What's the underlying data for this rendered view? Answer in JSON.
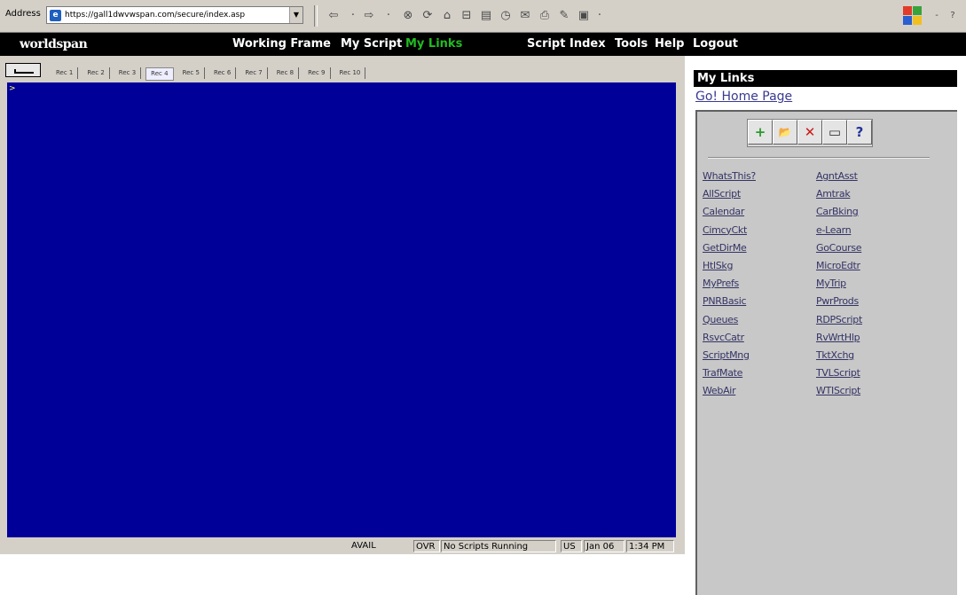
{
  "browser": {
    "address_label": "Address",
    "url": "https://gall1dwvwspan.com/secure/index.asp",
    "toolbar_icons": [
      "back-icon",
      "forward-icon",
      "stop-icon",
      "refresh-icon",
      "home-icon",
      "search-icon",
      "favorites-icon",
      "history-icon",
      "mail-icon",
      "print-icon",
      "edit-icon",
      "discuss-icon"
    ]
  },
  "app": {
    "brand": "worldspan",
    "nav": {
      "working_frame": "Working Frame",
      "my_script": "My Script",
      "my_links": "My Links",
      "script_index": "Script Index",
      "tools": "Tools",
      "help": "Help",
      "logout": "Logout"
    },
    "active_nav": "My Links",
    "accent_color": "#22bb22"
  },
  "work_area": {
    "rec_tabs": [
      "Rec 1",
      "Rec 2",
      "Rec 3",
      "Rec 4",
      "Rec 5",
      "Rec 6",
      "Rec 7",
      "Rec 8",
      "Rec 9",
      "Rec 10"
    ],
    "active_rec_tab": "Rec 4",
    "terminal_color": "#000099",
    "prompt": ">"
  },
  "status_bar": {
    "avail": "AVAIL",
    "ovr": "OVR",
    "script_status": "No Scripts Running",
    "locale": "US",
    "date": "Jan 06",
    "time": "1:34 PM"
  },
  "my_links": {
    "title": "My Links",
    "home_link": "Go! Home Page",
    "toolbar": [
      {
        "icon": "add-icon",
        "glyph": "+"
      },
      {
        "icon": "open-folder-icon",
        "glyph": "📂"
      },
      {
        "icon": "delete-icon",
        "glyph": "✕"
      },
      {
        "icon": "window-icon",
        "glyph": "▭"
      },
      {
        "icon": "help-icon",
        "glyph": "?"
      }
    ],
    "col1": [
      "WhatsThis?",
      "AllScript",
      "Calendar",
      "CimcyCkt",
      "GetDirMe",
      "HtlSkg",
      "MyPrefs",
      "PNRBasic",
      "Queues",
      "RsvcCatr",
      "ScriptMng",
      "TrafMate",
      "WebAir"
    ],
    "col2": [
      "AgntAsst",
      "Amtrak",
      "CarBking",
      "e-Learn",
      "GoCourse",
      "MicroEdtr",
      "MyTrip",
      "PwrProds",
      "RDPScript",
      "RvWrtHlp",
      "TktXchg",
      "TVLScript",
      "WTIScript"
    ]
  }
}
